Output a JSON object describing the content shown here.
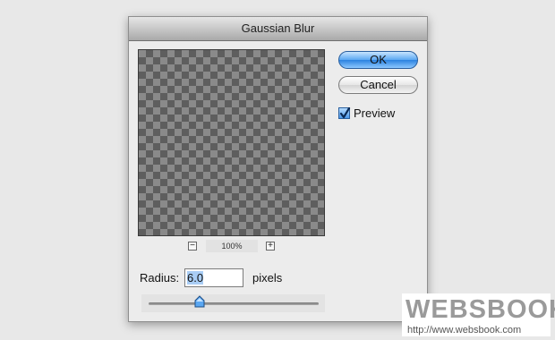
{
  "dialog": {
    "title": "Gaussian Blur",
    "ok_label": "OK",
    "cancel_label": "Cancel",
    "preview_label": "Preview",
    "preview_checked": true,
    "zoom_out_symbol": "−",
    "zoom_in_symbol": "+",
    "zoom_level": "100%",
    "radius_label": "Radius:",
    "radius_value": "6.0",
    "radius_units": "pixels",
    "slider_value_fraction": 0.3
  },
  "watermark": {
    "text": "WEBSBOOK",
    "url": "http://www.websbook.com"
  },
  "colors": {
    "accent": "#2c82e0",
    "dialog_bg": "#ececec",
    "checker_dark": "#5e5e5e",
    "checker_light": "#8a8a8a"
  },
  "icons": [
    "zoom-out-icon",
    "zoom-in-icon",
    "checkmark-icon",
    "slider-thumb-icon"
  ]
}
